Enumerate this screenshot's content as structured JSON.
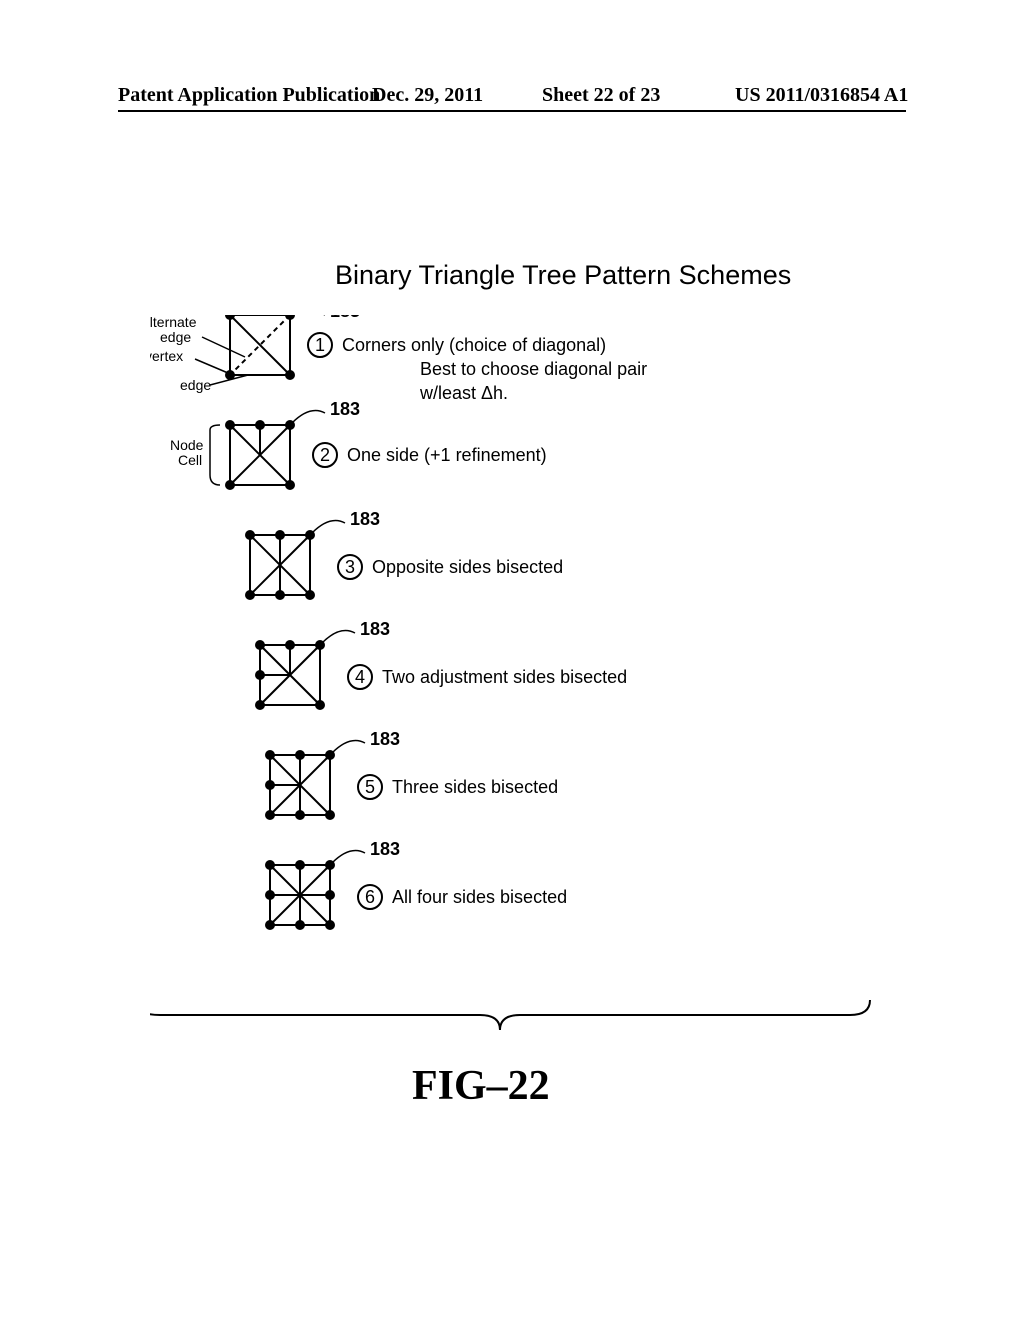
{
  "header": {
    "left": "Patent Application Publication",
    "date": "Dec. 29, 2011",
    "sheet": "Sheet 22 of 23",
    "pubnum": "US 2011/0316854 A1"
  },
  "title": "Binary Triangle Tree Pattern Schemes",
  "labels": {
    "edge_top": "edge",
    "alt_edge": "alternate\nedge",
    "vertex": "vertex",
    "edge_bot": "edge",
    "node_cell": "Node\nCell",
    "ref_183": "183"
  },
  "schemes": [
    {
      "n": "1",
      "desc": "Corners only (choice of diagonal)",
      "sub1": "Best to choose diagonal pair",
      "sub2": "w/least Δh."
    },
    {
      "n": "2",
      "desc": "One side (+1 refinement)"
    },
    {
      "n": "3",
      "desc": "Opposite sides bisected"
    },
    {
      "n": "4",
      "desc": "Two adjustment sides bisected"
    },
    {
      "n": "5",
      "desc": "Three sides bisected"
    },
    {
      "n": "6",
      "desc": "All four sides bisected"
    }
  ],
  "figure_label": "FIG–22"
}
